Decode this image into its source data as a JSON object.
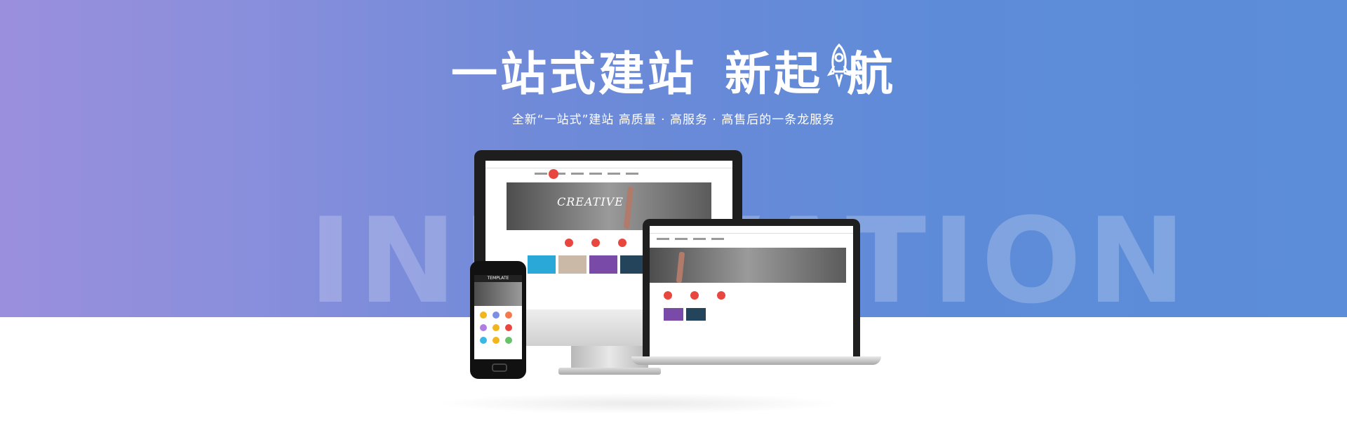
{
  "hero": {
    "title_part1": "一站式建站",
    "title_part2_pre": "新起",
    "title_part2_post": "航",
    "subtitle": "全新“一站式”建站   高质量 · 高服务 · 高售后的一条龙服务",
    "background_word": "INNOVATION",
    "colors": {
      "gradient_left": "#9a8fdd",
      "gradient_right": "#5b8dd8",
      "text": "#ffffff"
    }
  },
  "devices": {
    "banner_text": "CREATIVE",
    "phone_header": "TEMPLATE",
    "icons": [
      "rocket-icon"
    ]
  }
}
